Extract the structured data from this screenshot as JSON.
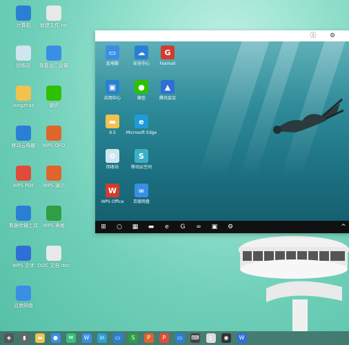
{
  "desktop": {
    "icons": [
      {
        "label": "计算机",
        "icon": "computer-icon",
        "color": "#2a7fd4"
      },
      {
        "label": "新建文件.txt",
        "icon": "text-file-icon",
        "color": "#e8e8e8"
      },
      {
        "label": "回收站",
        "icon": "recycle-bin-icon",
        "color": "#cfe6f0"
      },
      {
        "label": "恢复出厂设置",
        "icon": "browser-icon",
        "color": "#3a8ee6"
      },
      {
        "label": "langzhao",
        "icon": "folder-icon",
        "color": "#f2c14e"
      },
      {
        "label": "微信",
        "icon": "wechat-icon",
        "color": "#2dc100"
      },
      {
        "label": "移动云电脑",
        "icon": "cloud-pc-icon",
        "color": "#2a7fd4"
      },
      {
        "label": "WPS OFD",
        "icon": "wps-ofd-icon",
        "color": "#e0652a"
      },
      {
        "label": "WPS PDF",
        "icon": "wps-pdf-icon",
        "color": "#e04b3a"
      },
      {
        "label": "WPS 演示",
        "icon": "wps-ppt-icon",
        "color": "#e0652a"
      },
      {
        "label": "数据传输工具",
        "icon": "transfer-icon",
        "color": "#2a7fd4"
      },
      {
        "label": "WPS 表格",
        "icon": "wps-sheet-icon",
        "color": "#2f9e44"
      },
      {
        "label": "WPS 文字",
        "icon": "wps-doc-icon",
        "color": "#2f6fd6"
      },
      {
        "label": "DOC 文档.doc",
        "icon": "doc-file-icon",
        "color": "#e8e8e8"
      },
      {
        "label": "百度网盘",
        "icon": "netdisk-icon",
        "color": "#3a8ee6"
      }
    ]
  },
  "window": {
    "titlebar": {
      "info_icon": "ⓘ",
      "settings_icon": "⚙"
    },
    "remote_icons": [
      {
        "label": "此电脑",
        "icon": "this-pc-icon",
        "color": "#3a8ee6",
        "glyph": "▭"
      },
      {
        "label": "安全中心",
        "icon": "shield-icon",
        "color": "#2a7fd4",
        "glyph": "☁"
      },
      {
        "label": "Foxmail",
        "icon": "foxmail-icon",
        "color": "#d23b2e",
        "glyph": "G"
      },
      {
        "label": "应用中心",
        "icon": "app-center-icon",
        "color": "#2a7fd4",
        "glyph": "▣"
      },
      {
        "label": "微信",
        "icon": "wechat-icon",
        "color": "#2dc100",
        "glyph": "●"
      },
      {
        "label": "腾讯会议",
        "icon": "tencent-meeting-icon",
        "color": "#2f6fd6",
        "glyph": "▲"
      },
      {
        "label": "9.5",
        "icon": "folder-icon",
        "color": "#f2c14e",
        "glyph": "▬"
      },
      {
        "label": "Microsoft Edge",
        "icon": "edge-icon",
        "color": "#1f9bd8",
        "glyph": "e"
      },
      {
        "label": "回收站",
        "icon": "recycle-bin-icon",
        "color": "#cfe6f0",
        "glyph": "♻"
      },
      {
        "label": "移动云空间",
        "icon": "cloud-space-icon",
        "color": "#3ab0c8",
        "glyph": "S"
      },
      {
        "label": "WPS Office",
        "icon": "wps-office-icon",
        "color": "#d23b2e",
        "glyph": "W"
      },
      {
        "label": "百度网盘",
        "icon": "netdisk-icon",
        "color": "#3a8ee6",
        "glyph": "∞"
      }
    ],
    "taskbar": [
      "windows-start-icon",
      "search-icon",
      "task-view-icon",
      "file-explorer-icon",
      "edge-icon",
      "foxmail-icon",
      "netdisk-icon",
      "store-icon",
      "settings-icon"
    ],
    "taskbar_glyphs": [
      "⊞",
      "○",
      "▦",
      "▬",
      "e",
      "G",
      "∞",
      "▣",
      "⚙"
    ],
    "tray": "^"
  },
  "dock": {
    "items": [
      {
        "icon": "launcher-icon",
        "glyph": "◈",
        "color": "#555"
      },
      {
        "icon": "panel-icon",
        "glyph": "▮",
        "color": "#666"
      },
      {
        "icon": "folder-icon",
        "glyph": "▬",
        "color": "#f2c14e"
      },
      {
        "icon": "browser-icon",
        "glyph": "●",
        "color": "#3a8ee6"
      },
      {
        "icon": "mail-icon",
        "glyph": "✉",
        "color": "#3abf7a"
      },
      {
        "icon": "wps-icon",
        "glyph": "W",
        "color": "#3a8ee6"
      },
      {
        "icon": "pinyin-icon",
        "glyph": "in",
        "color": "#2a9fd6"
      },
      {
        "icon": "cloud-pc-icon",
        "glyph": "▭",
        "color": "#2a7fd4"
      },
      {
        "icon": "wps-sheet-icon",
        "glyph": "S",
        "color": "#2f9e44"
      },
      {
        "icon": "wps-ppt-icon",
        "glyph": "P",
        "color": "#e0652a"
      },
      {
        "icon": "wps-pdf-icon",
        "glyph": "P",
        "color": "#e04b3a"
      },
      {
        "icon": "remote-desktop-icon",
        "glyph": "▭",
        "color": "#2a7fd4"
      },
      {
        "icon": "keyboard-icon",
        "glyph": "⌨",
        "color": "#444"
      },
      {
        "icon": "file-icon",
        "glyph": "▯",
        "color": "#ddd"
      },
      {
        "icon": "camera-icon",
        "glyph": "◉",
        "color": "#333"
      },
      {
        "icon": "wps-doc-icon",
        "glyph": "W",
        "color": "#2f6fd6"
      }
    ]
  }
}
